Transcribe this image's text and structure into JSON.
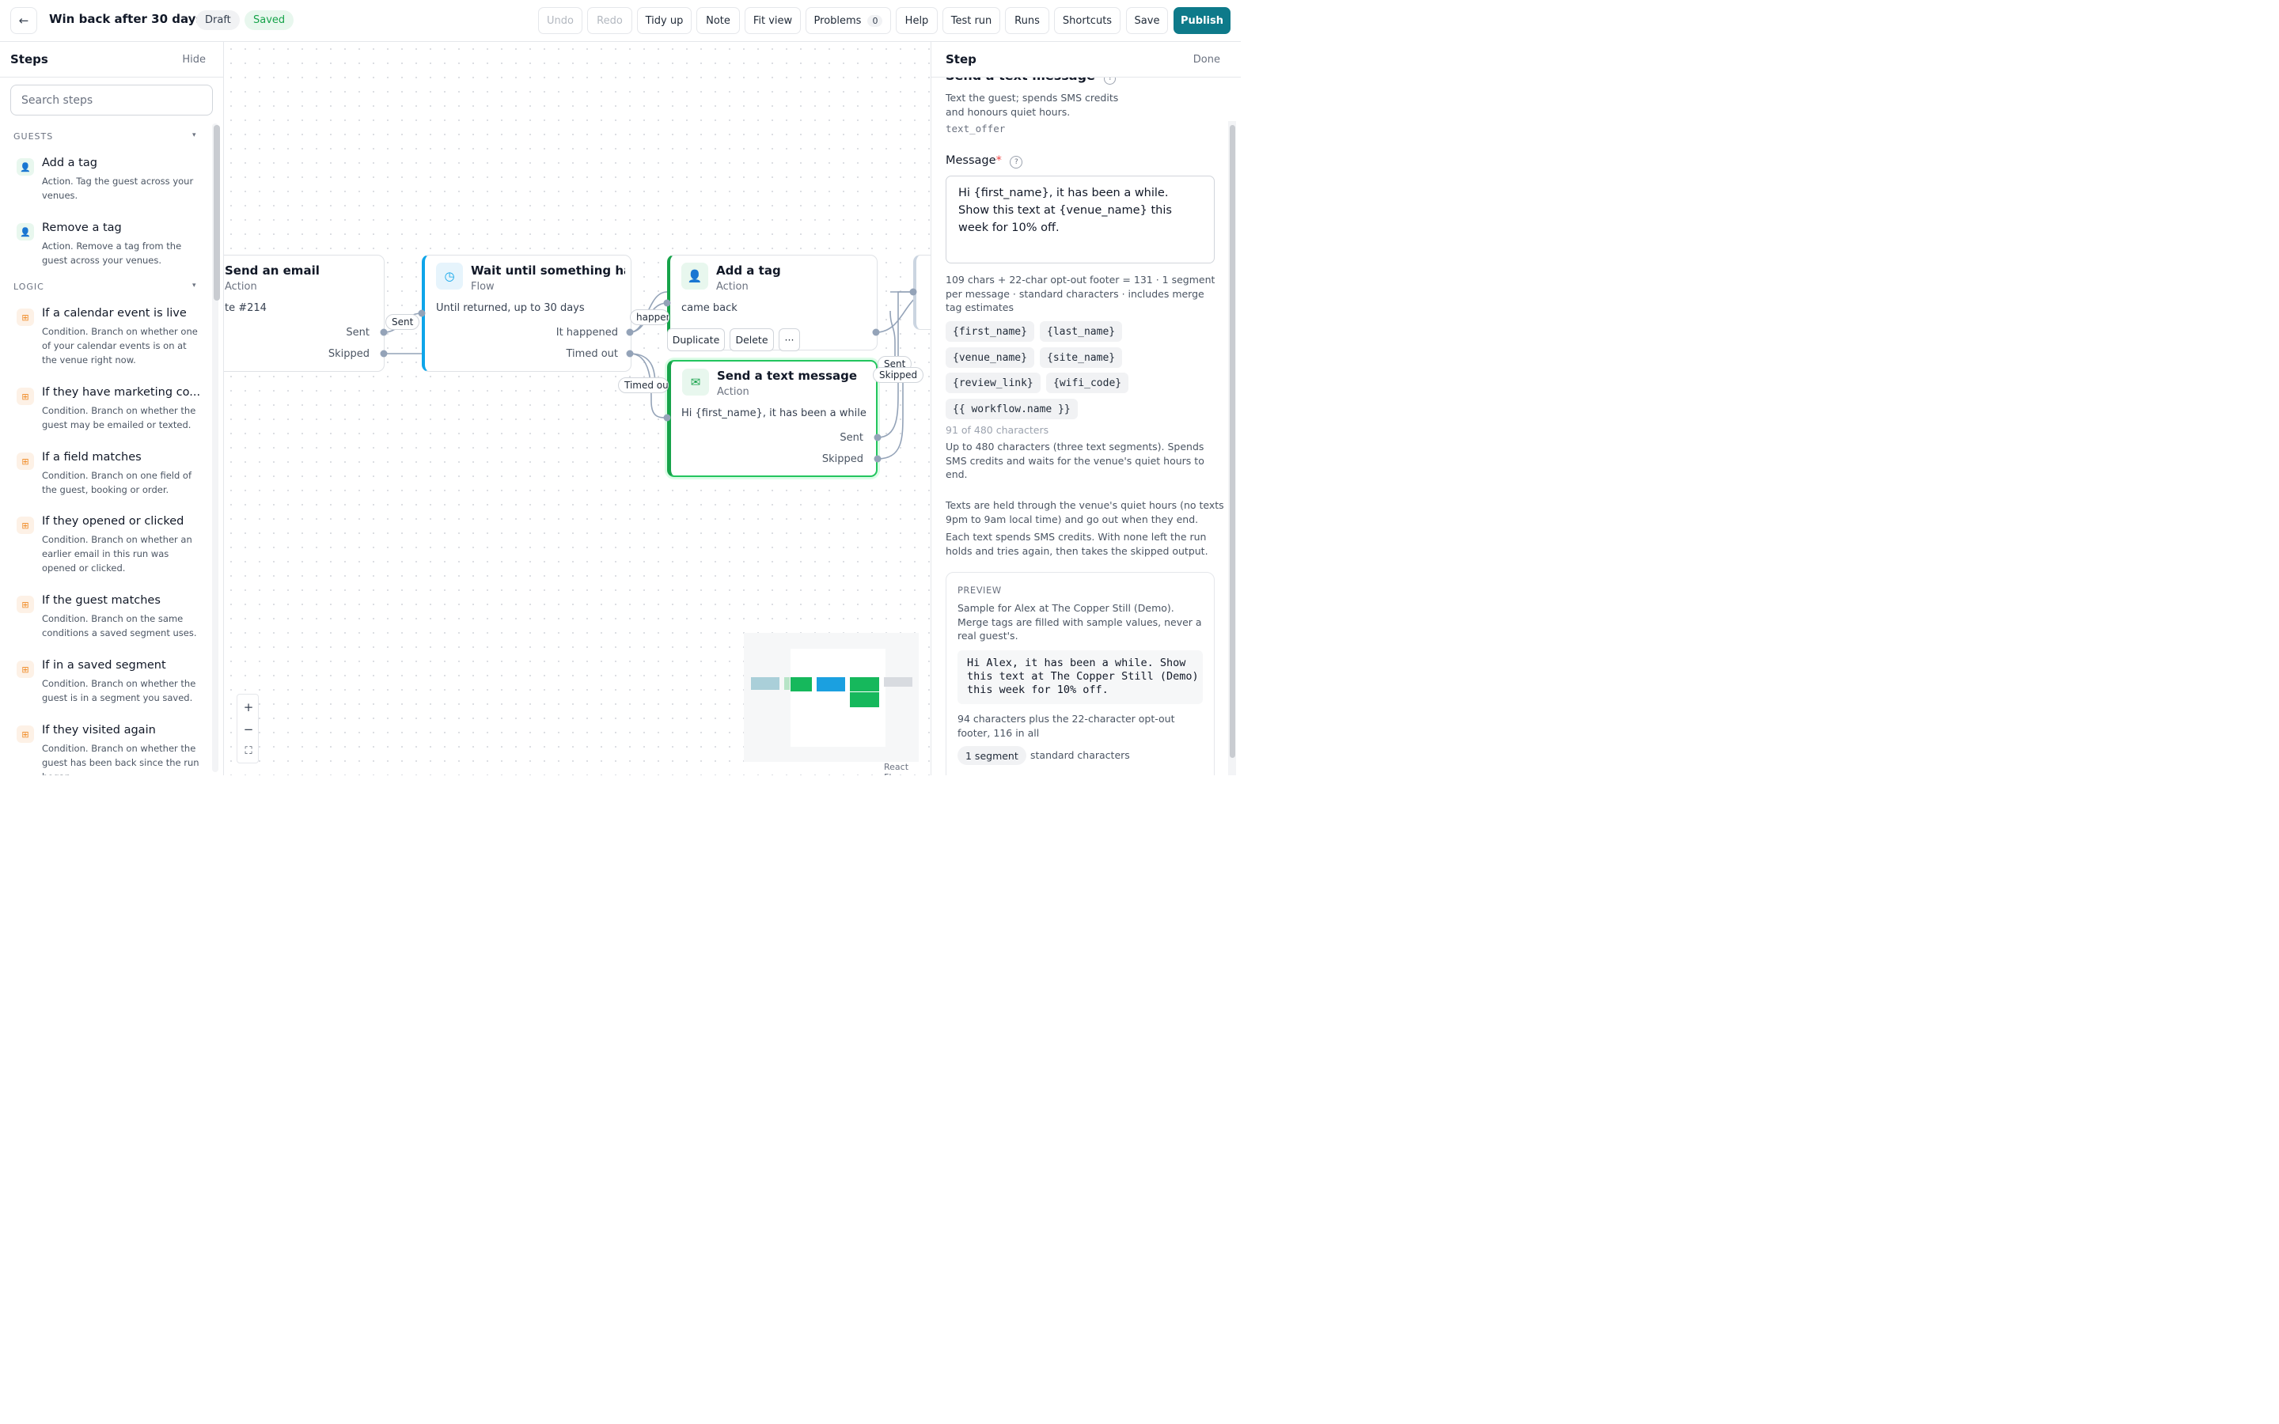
{
  "header": {
    "back_icon": "arrow-left-icon",
    "title": "Win back after 30 days",
    "status_draft": "Draft",
    "status_saved": "Saved",
    "buttons": {
      "undo": "Undo",
      "redo": "Redo",
      "tidy": "Tidy up",
      "note": "Note",
      "fit": "Fit view",
      "problems": "Problems",
      "problems_count": "0",
      "help": "Help",
      "test_run": "Test run",
      "runs": "Runs",
      "shortcuts": "Shortcuts",
      "save": "Save",
      "publish": "Publish"
    },
    "colors": {
      "accent": "#0f766e",
      "saved_bg": "#e8f7ee",
      "saved_fg": "#16a34a"
    }
  },
  "steps_panel": {
    "title": "Steps",
    "hide": "Hide",
    "search_placeholder": "Search steps",
    "sections": [
      {
        "label": "GUESTS",
        "items": [
          {
            "icon": "person-icon",
            "title": "Add a tag",
            "desc": "Action. Tag the guest across your venues."
          },
          {
            "icon": "person-icon",
            "title": "Remove a tag",
            "desc": "Action. Remove a tag from the guest across your venues."
          }
        ]
      },
      {
        "label": "LOGIC",
        "items": [
          {
            "icon": "grid-icon",
            "title": "If a calendar event is live",
            "desc": "Condition. Branch on whether one of your calendar events is on at the venue right now."
          },
          {
            "icon": "grid-icon",
            "title": "If they have marketing co...",
            "desc": "Condition. Branch on whether the guest may be emailed or texted."
          },
          {
            "icon": "grid-icon",
            "title": "If a field matches",
            "desc": "Condition. Branch on one field of the guest, booking or order."
          },
          {
            "icon": "grid-icon",
            "title": "If they opened or clicked",
            "desc": "Condition. Branch on whether an earlier email in this run was opened or clicked."
          },
          {
            "icon": "grid-icon",
            "title": "If the guest matches",
            "desc": "Condition. Branch on the same conditions a saved segment uses."
          },
          {
            "icon": "grid-icon",
            "title": "If in a saved segment",
            "desc": "Condition. Branch on whether the guest is in a segment you saved."
          },
          {
            "icon": "grid-icon",
            "title": "If they visited again",
            "desc": "Condition. Branch on whether the guest has been back since the run began."
          }
        ]
      }
    ]
  },
  "canvas": {
    "nodes": {
      "email": {
        "title": "Send an email",
        "kind": "Action",
        "body": "te #214",
        "out1": "Sent",
        "out2": "Skipped"
      },
      "wait": {
        "title": "Wait until something ha...",
        "kind": "Flow",
        "body": "Until returned, up to 30 days",
        "out1": "It happened",
        "out2": "Timed out",
        "icon": "clock-icon"
      },
      "tag": {
        "title": "Add a tag",
        "kind": "Action",
        "body": "came back",
        "icon": "person-icon"
      },
      "sms": {
        "title": "Send a text message",
        "kind": "Action",
        "body": "Hi {first_name}, it has been a while....",
        "out1": "Sent",
        "out2": "Skipped",
        "icon": "envelope-icon"
      }
    },
    "edge_labels": {
      "sent": "Sent",
      "happened": "happene",
      "timed_out": "Timed ou",
      "sent2": "Sent",
      "skipped": "Skipped"
    },
    "hover_actions": {
      "duplicate": "Duplicate",
      "delete": "Delete",
      "more": "···"
    },
    "zoom": {
      "in": "+",
      "out": "−",
      "fit": "⛶"
    },
    "attribution": "React Flow"
  },
  "step_panel": {
    "title": "Step",
    "done": "Done",
    "step_name": "Send a text message",
    "step_desc": "Text the guest; spends SMS credits and honours quiet hours.",
    "step_key": "text_offer",
    "message_label": "Message",
    "required_mark": "*",
    "help_mark": "?",
    "message_value": "Hi {first_name}, it has been a while. Show this text at {venue_name} this week for 10% off.",
    "count_info": "109 chars + 22-char opt-out footer = 131 · 1 segment per message · standard characters · includes merge tag estimates",
    "merge_tags": [
      "{first_name}",
      "{last_name}",
      "{venue_name}",
      "{site_name}",
      "{review_link}",
      "{wifi_code}",
      "{{ workflow.name }}"
    ],
    "char_counter": "91 of 480 characters",
    "limit_note": "Up to 480 characters (three text segments). Spends SMS credits and waits for the venue's quiet hours to end.",
    "quiet_note": "Texts are held through the venue's quiet hours (no texts 9pm to 9am local time) and go out when they end.",
    "credits_note": "Each text spends SMS credits. With none left the run holds and tries again, then takes the skipped output.",
    "preview": {
      "label": "PREVIEW",
      "desc": "Sample for Alex at The Copper Still (Demo). Merge tags are filled with sample values, never a real guest's.",
      "text": "Hi Alex, it has been a while. Show\nthis text at The Copper Still (Demo)\nthis week for 10% off.",
      "count": "94 characters plus the 22-character opt-out footer, 116 in all",
      "segments": "1 segment",
      "charset": "standard characters"
    }
  }
}
